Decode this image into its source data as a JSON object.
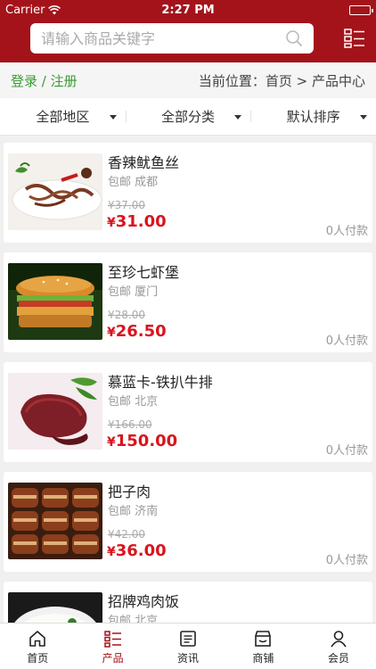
{
  "status": {
    "carrier": "Carrier",
    "time": "2:27 PM"
  },
  "search": {
    "placeholder": "请输入商品关键字"
  },
  "breadcrumb": {
    "login": "登录 / 注册",
    "location": "当前位置：首页 > 产品中心"
  },
  "filters": [
    {
      "label": "全部地区"
    },
    {
      "label": "全部分类"
    },
    {
      "label": "默认排序"
    }
  ],
  "products": [
    {
      "name": "香辣鱿鱼丝",
      "tags": "包邮 成都",
      "old_price": "¥37.00",
      "price_symbol": "¥",
      "price": "31.00",
      "paid": "0人付款"
    },
    {
      "name": "至珍七虾堡",
      "tags": "包邮 厦门",
      "old_price": "¥28.00",
      "price_symbol": "¥",
      "price": "26.50",
      "paid": "0人付款"
    },
    {
      "name": "慕蓝卡-铁扒牛排",
      "tags": "包邮 北京",
      "old_price": "¥166.00",
      "price_symbol": "¥",
      "price": "150.00",
      "paid": "0人付款"
    },
    {
      "name": "把子肉",
      "tags": "包邮 济南",
      "old_price": "¥42.00",
      "price_symbol": "¥",
      "price": "36.00",
      "paid": "0人付款"
    },
    {
      "name": "招牌鸡肉饭",
      "tags": "包邮 北京",
      "old_price": "",
      "price_symbol": "",
      "price": "",
      "paid": ""
    }
  ],
  "tabbar": [
    {
      "label": "首页",
      "icon": "home-icon"
    },
    {
      "label": "产品",
      "icon": "product-list-icon",
      "active": true
    },
    {
      "label": "资讯",
      "icon": "news-icon"
    },
    {
      "label": "商铺",
      "icon": "shop-icon"
    },
    {
      "label": "会员",
      "icon": "member-icon"
    }
  ],
  "colors": {
    "brand": "#a4131a",
    "price": "#d9151e",
    "login": "#3a9a35"
  }
}
